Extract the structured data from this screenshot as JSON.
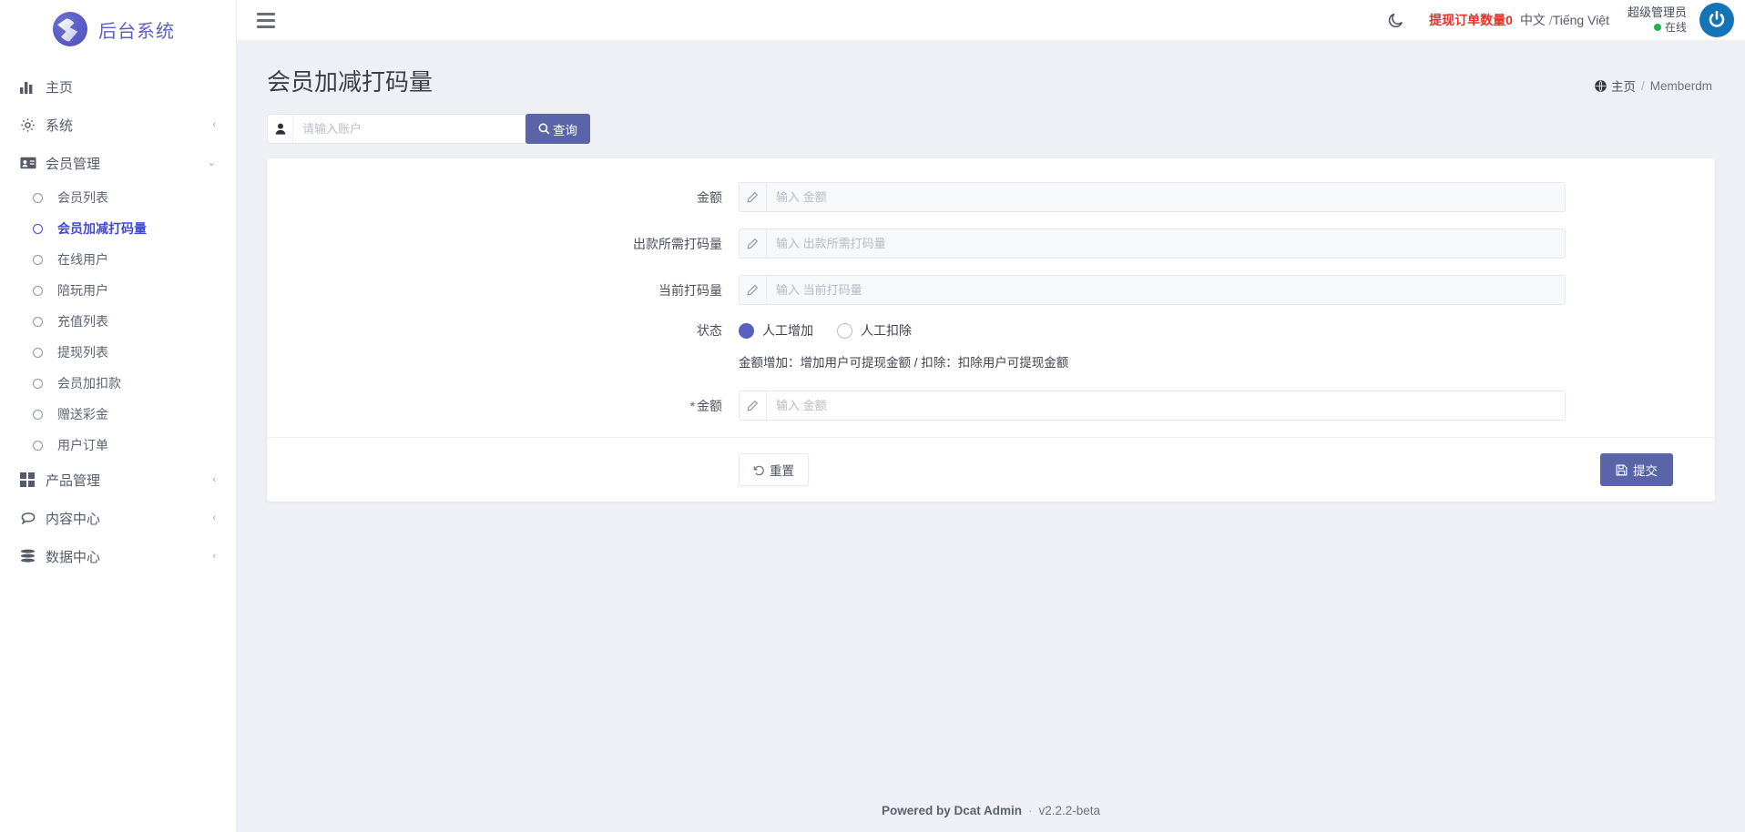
{
  "brand": {
    "name": "后台系统",
    "logo_icon": "circle-swoosh-logo"
  },
  "sidebar": {
    "items": [
      {
        "label": "主页",
        "icon": "bar-chart-icon",
        "caret": "",
        "key": "home"
      },
      {
        "label": "系统",
        "icon": "gear-icon",
        "caret": "‹",
        "key": "system"
      },
      {
        "label": "会员管理",
        "icon": "id-card-icon",
        "caret": "⌄",
        "key": "member"
      }
    ],
    "member_children": [
      {
        "label": "会员列表",
        "active": false
      },
      {
        "label": "会员加减打码量",
        "active": true
      },
      {
        "label": "在线用户",
        "active": false
      },
      {
        "label": "陪玩用户",
        "active": false
      },
      {
        "label": "充值列表",
        "active": false
      },
      {
        "label": "提现列表",
        "active": false
      },
      {
        "label": "会员加扣款",
        "active": false
      },
      {
        "label": "赠送彩金",
        "active": false
      },
      {
        "label": "用户订单",
        "active": false
      }
    ],
    "tail_items": [
      {
        "label": "产品管理",
        "icon": "grid-icon",
        "caret": "‹",
        "key": "product"
      },
      {
        "label": "内容中心",
        "icon": "chat-icon",
        "caret": "‹",
        "key": "content"
      },
      {
        "label": "数据中心",
        "icon": "database-icon",
        "caret": "‹",
        "key": "data"
      }
    ]
  },
  "topbar": {
    "menu_icon": "hamburger-icon",
    "theme_icon": "moon-icon",
    "withdraw_orders": "提现订单数量0",
    "lang_zh": "中文",
    "lang_sep": "/",
    "lang_vi": "Tiếng Việt",
    "user_name": "超级管理员",
    "user_status": "在线",
    "avatar_icon": "power-icon"
  },
  "page": {
    "title": "会员加减打码量",
    "breadcrumb_home": "主页",
    "breadcrumb_sep": "/",
    "breadcrumb_current": "Memberdm",
    "breadcrumb_icon": "globe-icon"
  },
  "search": {
    "icon": "user-icon",
    "placeholder": "请输入账户",
    "value": "",
    "button_label": "查询",
    "button_icon": "search-icon"
  },
  "form": {
    "fields": [
      {
        "label": "金额",
        "placeholder": "输入 金额",
        "value": "",
        "required": false,
        "readonly": true,
        "prefix_icon": "pencil-icon"
      },
      {
        "label": "出款所需打码量",
        "placeholder": "输入 出款所需打码量",
        "value": "",
        "required": false,
        "readonly": true,
        "prefix_icon": "pencil-icon"
      },
      {
        "label": "当前打码量",
        "placeholder": "输入 当前打码量",
        "value": "",
        "required": false,
        "readonly": true,
        "prefix_icon": "pencil-icon"
      }
    ],
    "status": {
      "label": "状态",
      "options": [
        {
          "label": "人工增加",
          "checked": true
        },
        {
          "label": "人工扣除",
          "checked": false
        }
      ]
    },
    "hint": "金额增加：增加用户可提现金额 / 扣除：扣除用户可提现金额",
    "amount_field": {
      "label": "金额",
      "placeholder": "输入 金额",
      "value": "",
      "required": true,
      "readonly": false,
      "prefix_icon": "pencil-icon"
    },
    "reset_label": "重置",
    "reset_icon": "undo-icon",
    "submit_label": "提交",
    "submit_icon": "save-icon"
  },
  "footer": {
    "powered": "Powered by Dcat Admin",
    "sep": "·",
    "version": "v2.2.2-beta"
  },
  "colors": {
    "accent": "#5a64a8",
    "brand": "#5b5fc7",
    "danger": "#e8302a",
    "active_link": "#4149d4",
    "online": "#22b14c",
    "avatar": "#1474b8"
  }
}
